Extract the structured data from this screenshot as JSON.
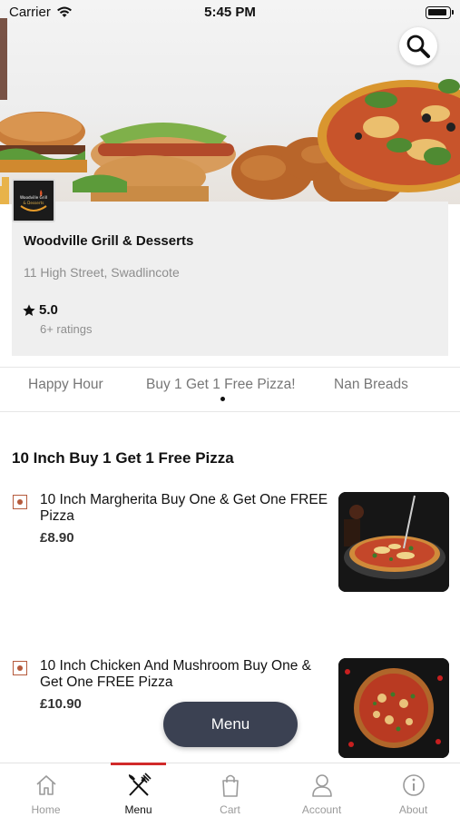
{
  "status_bar": {
    "carrier": "Carrier",
    "time": "5:45 PM"
  },
  "restaurant": {
    "logo_text": "Woodville Grill & Desserts",
    "name": "Woodville Grill & Desserts",
    "address": "11 High Street, Swadlincote",
    "rating": "5.0",
    "rating_count": "6+ ratings"
  },
  "categories": {
    "tabs": [
      "Happy Hour",
      "Buy 1 Get 1 Free Pizza!",
      "Nan Breads"
    ],
    "active_index": 1
  },
  "section": {
    "title": "10 Inch Buy 1 Get 1 Free Pizza"
  },
  "items": [
    {
      "name": "10 Inch Margherita Buy One & Get One FREE Pizza",
      "price": "£8.90"
    },
    {
      "name": "10 Inch Chicken And Mushroom Buy One & Get One FREE Pizza",
      "price": "£10.90"
    }
  ],
  "fab": {
    "label": "Menu"
  },
  "bottom_nav": [
    {
      "label": "Home",
      "icon": "home-icon"
    },
    {
      "label": "Menu",
      "icon": "fork-knife-icon",
      "active": true
    },
    {
      "label": "Cart",
      "icon": "shopping-bag-icon"
    },
    {
      "label": "Account",
      "icon": "person-icon"
    },
    {
      "label": "About",
      "icon": "info-icon"
    }
  ],
  "colors": {
    "accent": "#d12a2a",
    "fab_bg": "#3b4152",
    "veg_marker": "#b55a3c"
  }
}
